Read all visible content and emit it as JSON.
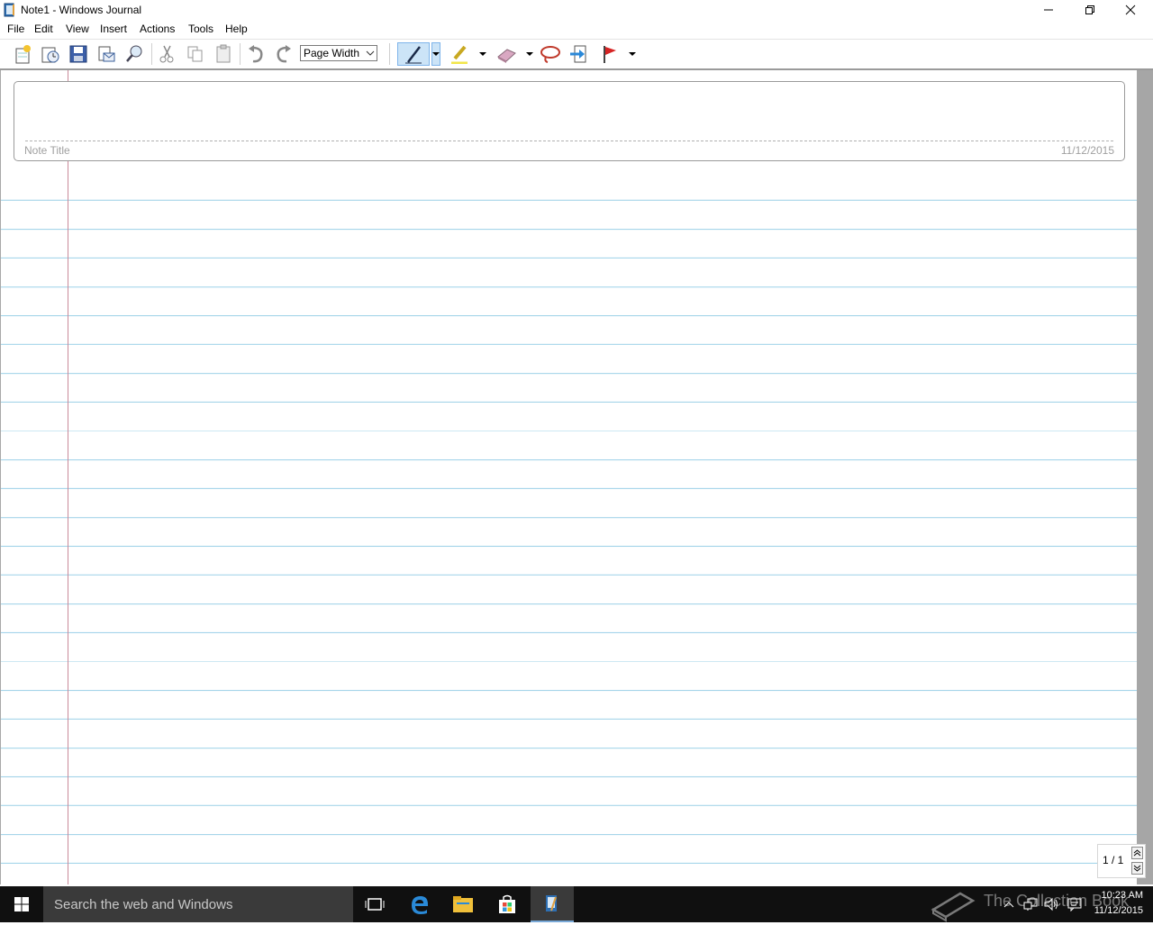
{
  "window": {
    "title": "Note1 - Windows Journal"
  },
  "menu": [
    "File",
    "Edit",
    "View",
    "Insert",
    "Actions",
    "Tools",
    "Help"
  ],
  "toolbar": {
    "zoom_value": "Page Width",
    "buttons": [
      "new-note",
      "new-from-template",
      "save",
      "send-email",
      "find",
      "cut",
      "copy",
      "paste",
      "undo",
      "redo",
      "pen",
      "highlighter",
      "eraser",
      "lasso-select",
      "insert-space",
      "flag"
    ]
  },
  "note": {
    "title_label": "Note Title",
    "date": "11/12/2015"
  },
  "page_nav": {
    "count": "1 / 1"
  },
  "taskbar": {
    "search_placeholder": "Search the web and Windows",
    "watermark": "The Collection Book",
    "time": "10:23 AM",
    "date": "11/12/2015"
  },
  "colors": {
    "ruled_line": "#9fd2e8",
    "margin_line": "#c98a9a",
    "taskbar": "#101010",
    "accent": "#79a9d8"
  }
}
